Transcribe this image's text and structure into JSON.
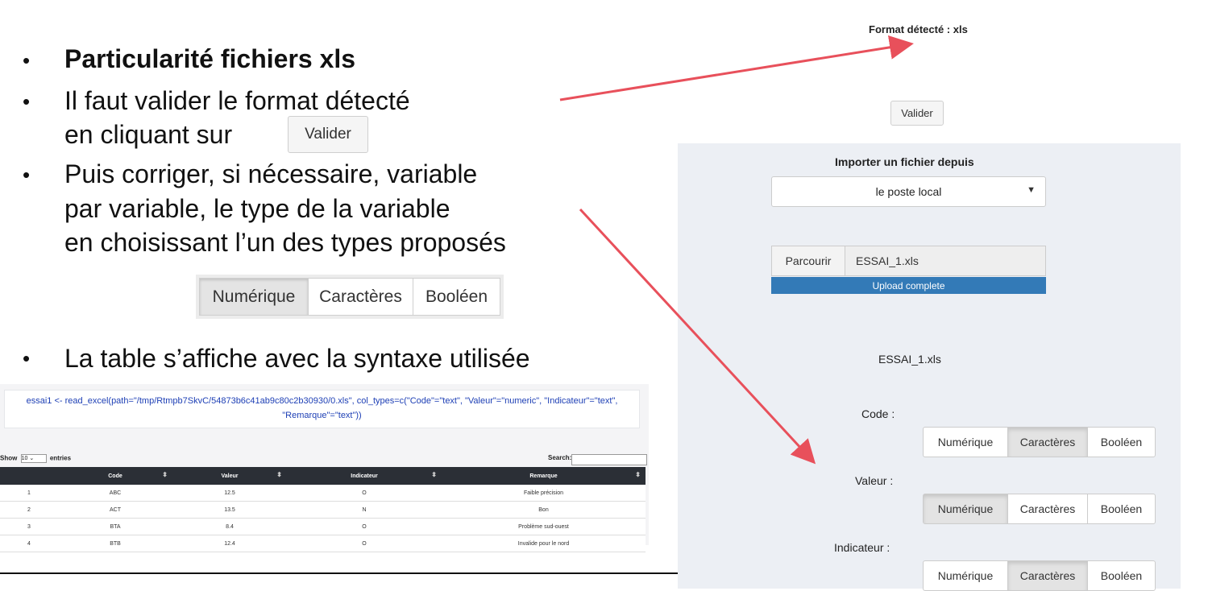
{
  "slide": {
    "bullets": [
      {
        "text": "Particularité fichiers xls",
        "bold": true
      },
      {
        "lines": [
          "Il faut valider le format détecté",
          "en cliquant sur"
        ],
        "inline_button": "Valider"
      },
      {
        "lines": [
          "Puis corriger, si nécessaire, variable",
          "par variable, le type de la variable",
          "en choisissant l’un des types proposés"
        ]
      },
      {
        "text": "La table s’affiche avec la syntaxe utilisée"
      }
    ],
    "type_buttons": [
      "Numérique",
      "Caractères",
      "Booléen"
    ],
    "type_buttons_active": "Numérique",
    "bullet_char": "•",
    "arrow_color": "#e8505b"
  },
  "code": {
    "line1": "essai1 <- read_excel(path=\"/tmp/Rtmpb7SkvC/54873b6c41ab9c80c2b30930/0.xls\", col_types=c(\"Code\"=\"text\", \"Valeur\"=\"numeric\", \"Indicateur\"=\"text\",",
    "line2": "\"Remarque\"=\"text\"))"
  },
  "datatable": {
    "show_label": "Show",
    "entries_value": "10",
    "entries_label": "entries",
    "search_label": "Search:",
    "columns": [
      "",
      "Code",
      "Valeur",
      "Indicateur",
      "Remarque"
    ],
    "rows": [
      [
        "1",
        "ABC",
        "12.5",
        "O",
        "Faible précision"
      ],
      [
        "2",
        "ACT",
        "13.5",
        "N",
        "Bon"
      ],
      [
        "3",
        "BTA",
        "8.4",
        "O",
        "Problème sud-ouest"
      ],
      [
        "4",
        "BTB",
        "12.4",
        "O",
        "Invalide pour le nord"
      ]
    ]
  },
  "right": {
    "format_label": "Format détecté : xls",
    "valider_label": "Valider",
    "import_label": "Importer un fichier depuis",
    "source_value": "le poste local",
    "browse_label": "Parcourir",
    "file_name": "ESSAI_1.xls",
    "upload_status": "Upload complete",
    "upload_progress": 1.0,
    "file_title": "ESSAI_1.xls",
    "variables": [
      {
        "label": "Code :",
        "active": "Caractères"
      },
      {
        "label": "Valeur :",
        "active": "Numérique"
      },
      {
        "label": "Indicateur :",
        "active": "Caractères"
      }
    ],
    "type_options": [
      "Numérique",
      "Caractères",
      "Booléen"
    ]
  }
}
